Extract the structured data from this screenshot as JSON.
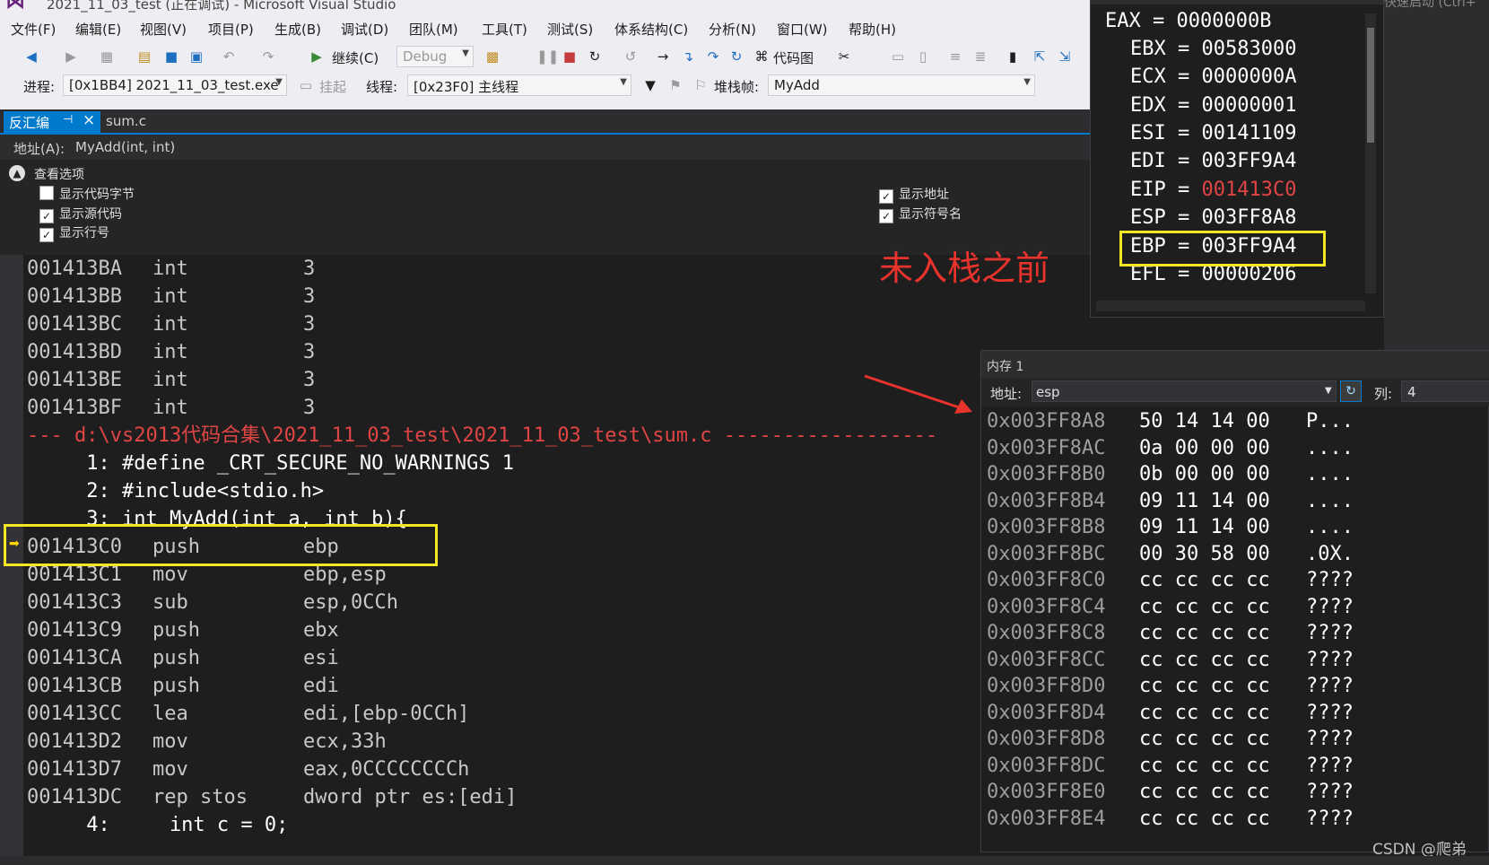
{
  "window": {
    "title": "2021_11_03_test (正在调试) - Microsoft Visual Studio"
  },
  "menu": [
    "文件(F)",
    "编辑(E)",
    "视图(V)",
    "项目(P)",
    "生成(B)",
    "调试(D)",
    "团队(M)",
    "工具(T)",
    "测试(S)",
    "体系结构(C)",
    "分析(N)",
    "窗口(W)",
    "帮助(H)"
  ],
  "toolbar": {
    "continue_label": "继续(C)",
    "config": "Debug",
    "codemap_label": "代码图"
  },
  "debugbar": {
    "process_label": "进程:",
    "process_value": "[0x1BB4] 2021_11_03_test.exe",
    "suspend_label": "挂起",
    "thread_label": "线程:",
    "thread_value": "[0x23F0] 主线程",
    "stackframe_label": "堆栈帧:",
    "stackframe_value": "MyAdd"
  },
  "tabs": {
    "active": "反汇编",
    "other": "sum.c"
  },
  "disasm": {
    "address_label": "地址(A):",
    "address_value": "MyAdd(int, int)",
    "view_options_label": "查看选项",
    "options": [
      {
        "label": "显示代码字节",
        "checked": false
      },
      {
        "label": "显示源代码",
        "checked": true
      },
      {
        "label": "显示行号",
        "checked": true
      },
      {
        "label": "显示地址",
        "checked": true
      },
      {
        "label": "显示符号名",
        "checked": true
      }
    ],
    "int_lines": [
      {
        "addr": "001413BA",
        "op": "int",
        "arg": "3"
      },
      {
        "addr": "001413BB",
        "op": "int",
        "arg": "3"
      },
      {
        "addr": "001413BC",
        "op": "int",
        "arg": "3"
      },
      {
        "addr": "001413BD",
        "op": "int",
        "arg": "3"
      },
      {
        "addr": "001413BE",
        "op": "int",
        "arg": "3"
      },
      {
        "addr": "001413BF",
        "op": "int",
        "arg": "3"
      }
    ],
    "path_line": "--- d:\\vs2013代码合集\\2021_11_03_test\\2021_11_03_test\\sum.c ------------------",
    "src_lines": [
      "     1: #define _CRT_SECURE_NO_WARNINGS 1",
      "     2: #include<stdio.h>",
      "     3: int MyAdd(int a, int b){"
    ],
    "asm_lines": [
      {
        "addr": "001413C0",
        "op": "push",
        "arg": "ebp"
      },
      {
        "addr": "001413C1",
        "op": "mov",
        "arg": "ebp,esp"
      },
      {
        "addr": "001413C3",
        "op": "sub",
        "arg": "esp,0CCh"
      },
      {
        "addr": "001413C9",
        "op": "push",
        "arg": "ebx"
      },
      {
        "addr": "001413CA",
        "op": "push",
        "arg": "esi"
      },
      {
        "addr": "001413CB",
        "op": "push",
        "arg": "edi"
      },
      {
        "addr": "001413CC",
        "op": "lea",
        "arg": "edi,[ebp-0CCh]"
      },
      {
        "addr": "001413D2",
        "op": "mov",
        "arg": "ecx,33h"
      },
      {
        "addr": "001413D7",
        "op": "mov",
        "arg": "eax,0CCCCCCCCh"
      },
      {
        "addr": "001413DC",
        "op": "rep stos",
        "arg": "dword ptr es:[edi]"
      }
    ],
    "src_line4": "     4:     int c = 0;"
  },
  "registers": [
    {
      "name": "EAX",
      "value": "0000000B",
      "changed": false
    },
    {
      "name": "EBX",
      "value": "00583000",
      "changed": false
    },
    {
      "name": "ECX",
      "value": "0000000A",
      "changed": false
    },
    {
      "name": "EDX",
      "value": "00000001",
      "changed": false
    },
    {
      "name": "ESI",
      "value": "00141109",
      "changed": false
    },
    {
      "name": "EDI",
      "value": "003FF9A4",
      "changed": false
    },
    {
      "name": "EIP",
      "value": "001413C0",
      "changed": true
    },
    {
      "name": "ESP",
      "value": "003FF8A8",
      "changed": false
    },
    {
      "name": "EBP",
      "value": "003FF9A4",
      "changed": false
    },
    {
      "name": "EFL",
      "value": "00000206",
      "changed": false
    }
  ],
  "annotation": "未入栈之前",
  "memory": {
    "title": "内存 1",
    "address_label": "地址:",
    "address_value": "esp",
    "columns_label": "列:",
    "columns_value": "4",
    "rows": [
      {
        "addr": "0x003FF8A8",
        "bytes": "50 14 14 00",
        "ascii": "P..."
      },
      {
        "addr": "0x003FF8AC",
        "bytes": "0a 00 00 00",
        "ascii": "...."
      },
      {
        "addr": "0x003FF8B0",
        "bytes": "0b 00 00 00",
        "ascii": "...."
      },
      {
        "addr": "0x003FF8B4",
        "bytes": "09 11 14 00",
        "ascii": "...."
      },
      {
        "addr": "0x003FF8B8",
        "bytes": "09 11 14 00",
        "ascii": "...."
      },
      {
        "addr": "0x003FF8BC",
        "bytes": "00 30 58 00",
        "ascii": ".0X."
      },
      {
        "addr": "0x003FF8C0",
        "bytes": "cc cc cc cc",
        "ascii": "????"
      },
      {
        "addr": "0x003FF8C4",
        "bytes": "cc cc cc cc",
        "ascii": "????"
      },
      {
        "addr": "0x003FF8C8",
        "bytes": "cc cc cc cc",
        "ascii": "????"
      },
      {
        "addr": "0x003FF8CC",
        "bytes": "cc cc cc cc",
        "ascii": "????"
      },
      {
        "addr": "0x003FF8D0",
        "bytes": "cc cc cc cc",
        "ascii": "????"
      },
      {
        "addr": "0x003FF8D4",
        "bytes": "cc cc cc cc",
        "ascii": "????"
      },
      {
        "addr": "0x003FF8D8",
        "bytes": "cc cc cc cc",
        "ascii": "????"
      },
      {
        "addr": "0x003FF8DC",
        "bytes": "cc cc cc cc",
        "ascii": "????"
      },
      {
        "addr": "0x003FF8E0",
        "bytes": "cc cc cc cc",
        "ascii": "????"
      },
      {
        "addr": "0x003FF8E4",
        "bytes": "cc cc cc cc",
        "ascii": "????"
      }
    ]
  },
  "side_panel_text": "快速启动 (Ctrl+",
  "watermark": "CSDN @爬弟",
  "colors": {
    "accent": "#007acc",
    "highlight_box": "#f3e623",
    "changed_value": "#e04545",
    "annotation": "#e8332d"
  }
}
